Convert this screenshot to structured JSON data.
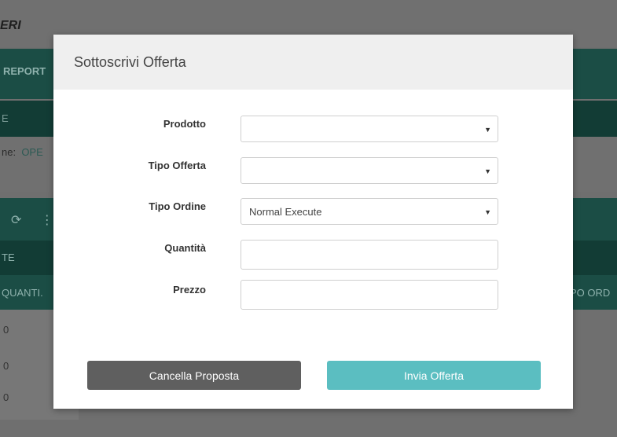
{
  "background": {
    "logo": "ERI",
    "nav_item": "REPORT",
    "section_text": "E",
    "filter_label": "ne:",
    "filter_value": "OPE",
    "toolbar_icons": "⟳ ⋮",
    "tab_label": "TE",
    "column_quantity": "QUANTI.",
    "column_type": "PO ORD",
    "row_values": [
      "0",
      "0",
      "0"
    ]
  },
  "modal": {
    "title": "Sottoscrivi Offerta",
    "fields": {
      "prodotto": {
        "label": "Prodotto",
        "value": ""
      },
      "tipo_offerta": {
        "label": "Tipo Offerta",
        "value": ""
      },
      "tipo_ordine": {
        "label": "Tipo Ordine",
        "value": "Normal Execute"
      },
      "quantita": {
        "label": "Quantità",
        "value": ""
      },
      "prezzo": {
        "label": "Prezzo",
        "value": ""
      }
    },
    "buttons": {
      "cancel": "Cancella Proposta",
      "submit": "Invia Offerta"
    }
  },
  "colors": {
    "cancel_button": "#5f5f5f",
    "submit_button": "#5bbec1",
    "overlay_teal": "#1b4d45"
  }
}
